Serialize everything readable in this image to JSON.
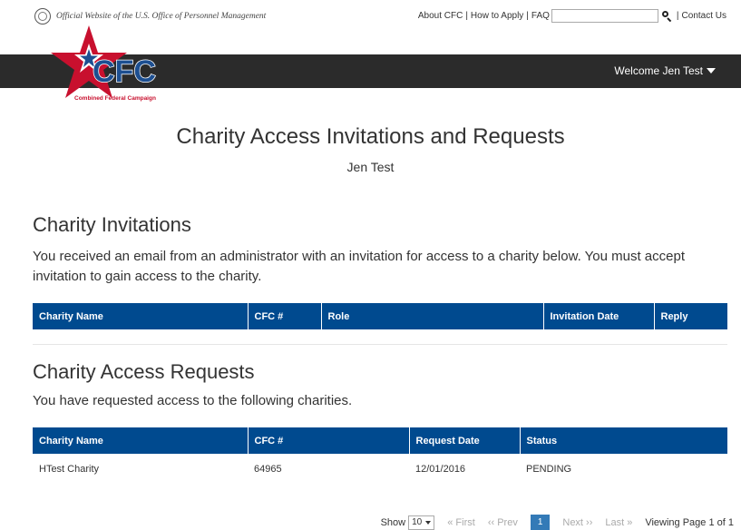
{
  "header": {
    "opm_text": "Official Website of the U.S. Office of Personnel Management",
    "links": [
      "About CFC",
      "How to Apply",
      "FAQ"
    ],
    "contact": "Contact Us",
    "welcome": "Welcome Jen Test",
    "logo_text": "CFC",
    "logo_caption": "Combined Federal Campaign"
  },
  "page": {
    "title": "Charity Access Invitations and Requests",
    "subtitle": "Jen Test"
  },
  "invitations": {
    "heading": "Charity Invitations",
    "text": "You received an email from an administrator with an invitation for access to a charity below. You must accept invitation to gain access to the charity.",
    "columns": [
      "Charity Name",
      "CFC #",
      "Role",
      "Invitation Date",
      "Reply"
    ]
  },
  "requests": {
    "heading": "Charity Access Requests",
    "text": "You have requested access to the following charities.",
    "columns": [
      "Charity Name",
      "CFC #",
      "Request Date",
      "Status"
    ],
    "rows": [
      {
        "name": "HTest Charity",
        "cfc": "64965",
        "date": "12/01/2016",
        "status": "PENDING"
      }
    ]
  },
  "pagination": {
    "show_label": "Show",
    "page_size": "10",
    "first": "« First",
    "prev": "‹‹ Prev",
    "current": "1",
    "next": "Next ››",
    "last": "Last »",
    "viewing": "Viewing Page 1 of 1"
  },
  "colors": {
    "table_header": "#004a8f",
    "header_bar": "#2b2b2b",
    "brand_red": "#c8102e",
    "brand_blue": "#1d4f91"
  }
}
